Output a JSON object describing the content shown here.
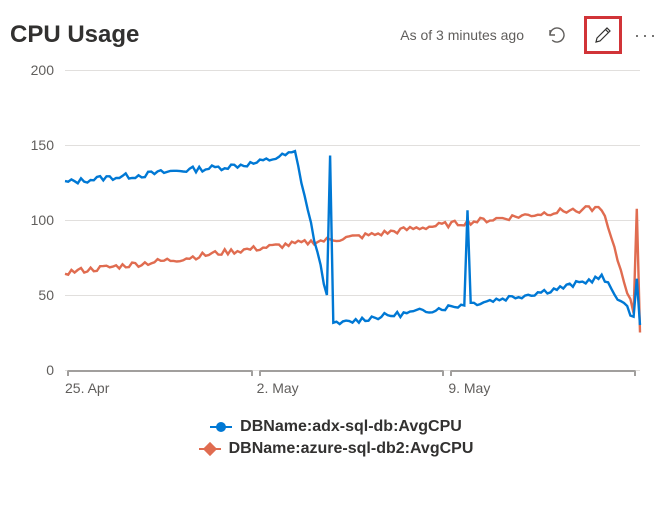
{
  "header": {
    "title": "CPU Usage",
    "status": "As of 3 minutes ago"
  },
  "colors": {
    "series1": "#0078d4",
    "series2": "#e06c50"
  },
  "chart_data": {
    "type": "line",
    "ylabel": "",
    "xlabel": "",
    "ylim": [
      0,
      200
    ],
    "y_ticks": [
      0,
      50,
      100,
      150,
      200
    ],
    "x_ticks": [
      "25. Apr",
      "2. May",
      "9. May"
    ],
    "x": [
      "25 Apr",
      "26 Apr",
      "27 Apr",
      "28 Apr",
      "29 Apr",
      "30 Apr",
      "1 May",
      "2 May",
      "3 May",
      "4 May",
      "5 May",
      "6 May",
      "7 May",
      "8 May",
      "9 May",
      "10 May"
    ],
    "series": [
      {
        "name": "DBName:adx-sql-db:AvgCPU",
        "values": [
          125,
          128,
          130,
          133,
          135,
          138,
          145,
          30,
          35,
          38,
          42,
          46,
          50,
          55,
          62,
          30
        ]
      },
      {
        "name": "DBName:azure-sql-db2:AvgCPU",
        "values": [
          65,
          68,
          71,
          74,
          78,
          81,
          84,
          87,
          90,
          94,
          97,
          100,
          103,
          106,
          108,
          25
        ]
      }
    ]
  },
  "legend": [
    "DBName:adx-sql-db:AvgCPU",
    "DBName:azure-sql-db2:AvgCPU"
  ]
}
